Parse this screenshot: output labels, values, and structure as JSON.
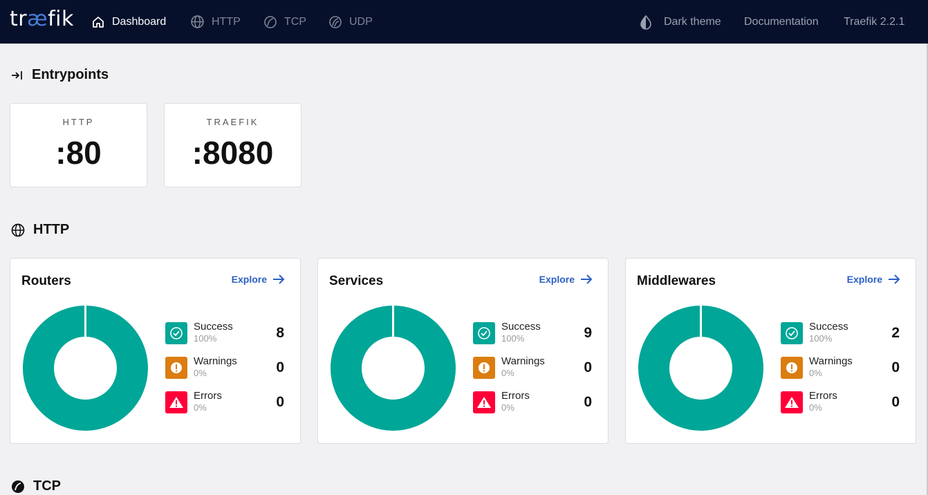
{
  "navbar": {
    "logo_prefix": "tr",
    "logo_ae": "æ",
    "logo_suffix": "fik",
    "items": [
      {
        "label": "Dashboard",
        "icon": "home-icon"
      },
      {
        "label": "HTTP",
        "icon": "globe-icon"
      },
      {
        "label": "TCP",
        "icon": "tcp-icon"
      },
      {
        "label": "UDP",
        "icon": "udp-icon"
      }
    ],
    "dark_theme_label": "Dark theme",
    "documentation_label": "Documentation",
    "version_label": "Traefik 2.2.1"
  },
  "entrypoints": {
    "title": "Entrypoints",
    "items": [
      {
        "name": "HTTP",
        "port": ":80"
      },
      {
        "name": "TRAEFIK",
        "port": ":8080"
      }
    ]
  },
  "http": {
    "title": "HTTP",
    "explore_label": "Explore",
    "cards": [
      {
        "title": "Routers",
        "success_label": "Success",
        "success_pct": "100%",
        "success_count": "8",
        "warnings_label": "Warnings",
        "warnings_pct": "0%",
        "warnings_count": "0",
        "errors_label": "Errors",
        "errors_pct": "0%",
        "errors_count": "0"
      },
      {
        "title": "Services",
        "success_label": "Success",
        "success_pct": "100%",
        "success_count": "9",
        "warnings_label": "Warnings",
        "warnings_pct": "0%",
        "warnings_count": "0",
        "errors_label": "Errors",
        "errors_pct": "0%",
        "errors_count": "0"
      },
      {
        "title": "Middlewares",
        "success_label": "Success",
        "success_pct": "100%",
        "success_count": "2",
        "warnings_label": "Warnings",
        "warnings_pct": "0%",
        "warnings_count": "0",
        "errors_label": "Errors",
        "errors_pct": "0%",
        "errors_count": "0"
      }
    ]
  },
  "tcp": {
    "title": "TCP"
  },
  "colors": {
    "navbar_bg": "#06102b",
    "success": "#00a697",
    "warning": "#db7d11",
    "error": "#ff0039",
    "link": "#2a5fc4"
  }
}
